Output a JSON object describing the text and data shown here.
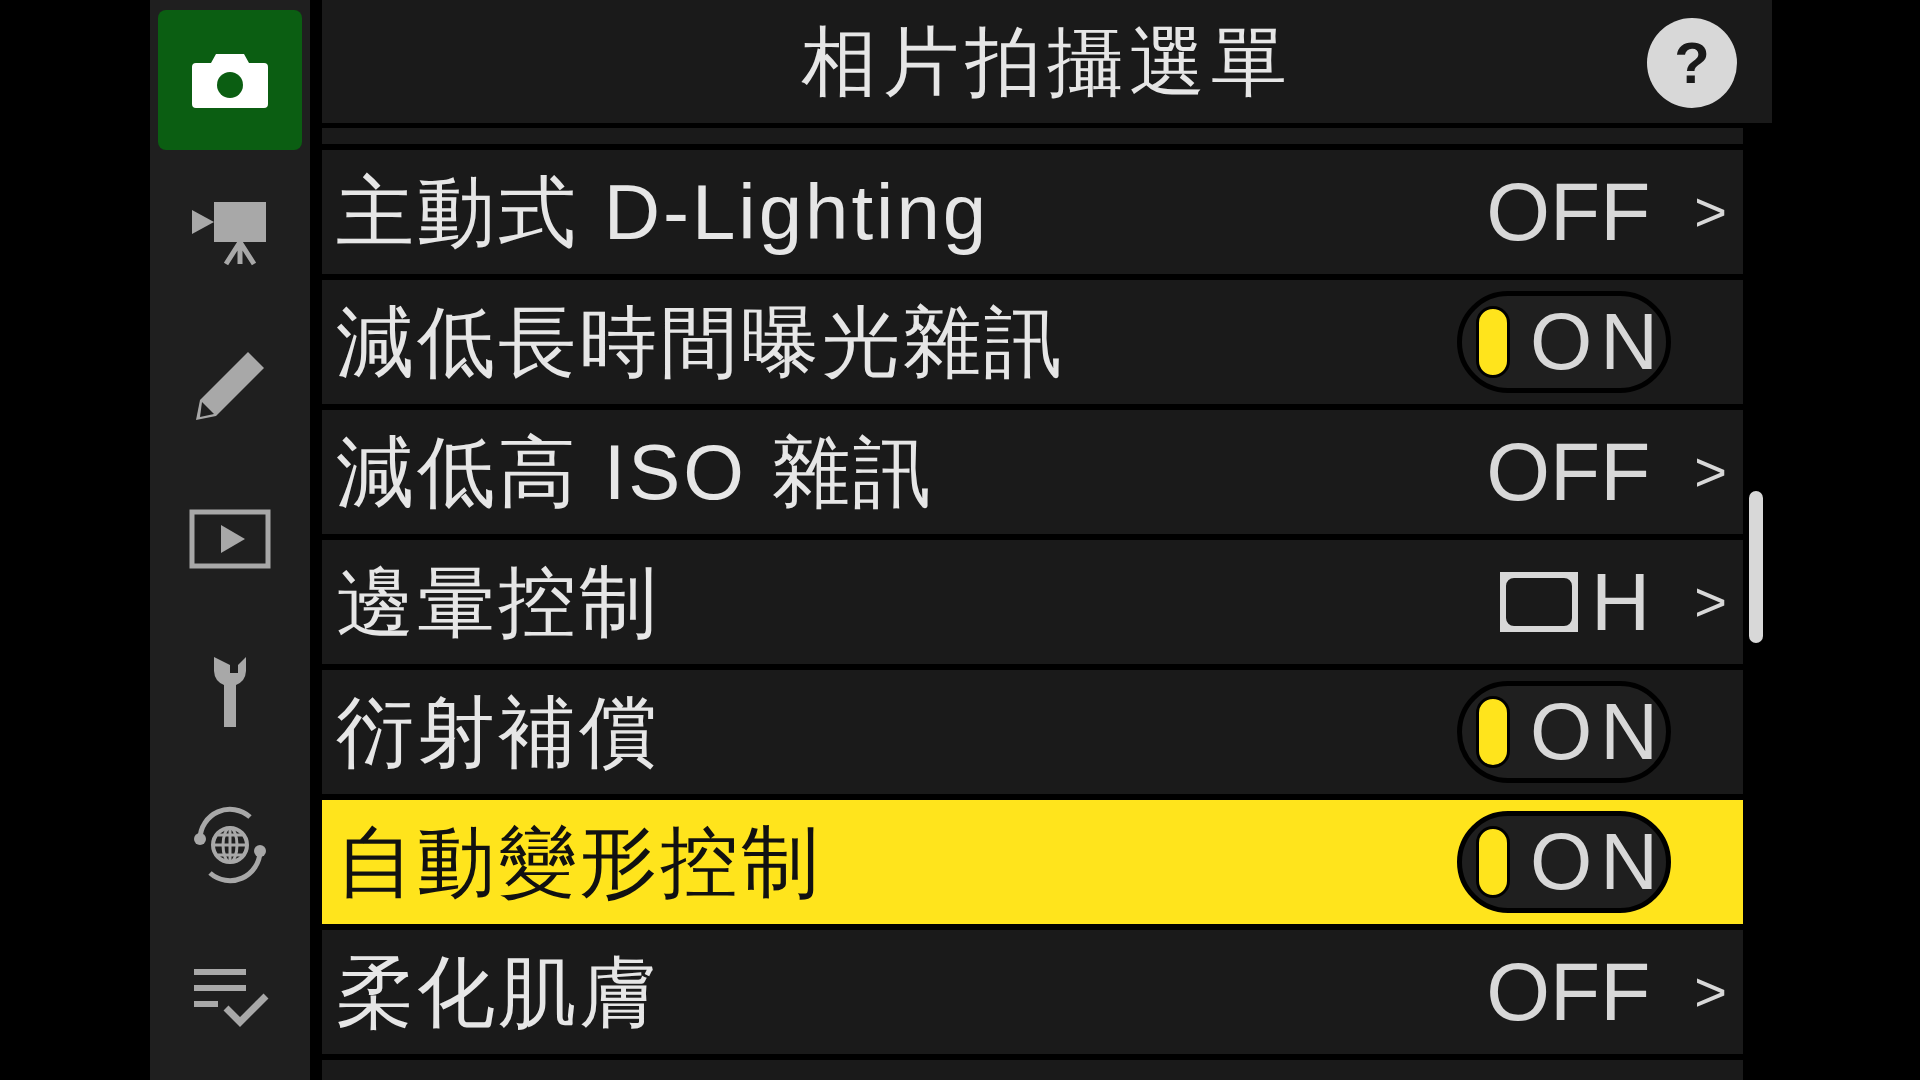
{
  "sidebar": {
    "items": [
      {
        "kind": "photo",
        "selected": true
      },
      {
        "kind": "movie",
        "selected": false
      },
      {
        "kind": "retouch",
        "selected": false
      },
      {
        "kind": "playback",
        "selected": false
      },
      {
        "kind": "setup",
        "selected": false
      },
      {
        "kind": "network",
        "selected": false
      },
      {
        "kind": "mymenu",
        "selected": false
      }
    ]
  },
  "header": {
    "title": "相片拍攝選單",
    "help": "?"
  },
  "menu": {
    "items": [
      {
        "kind": "value",
        "label": "主動式 D-Lighting",
        "value": "OFF",
        "arrow": ">",
        "selected": false
      },
      {
        "kind": "toggle",
        "label": "減低長時間曝光雜訊",
        "value": "ON",
        "on": true,
        "selected": false
      },
      {
        "kind": "value",
        "label": "減低高 ISO 雜訊",
        "value": "OFF",
        "arrow": ">",
        "selected": false
      },
      {
        "kind": "vignette",
        "label": "邊暈控制",
        "value": "H",
        "arrow": ">",
        "selected": false
      },
      {
        "kind": "toggle",
        "label": "衍射補償",
        "value": "ON",
        "on": true,
        "selected": false
      },
      {
        "kind": "toggle",
        "label": "自動變形控制",
        "value": "ON",
        "on": true,
        "selected": true
      },
      {
        "kind": "value",
        "label": "柔化肌膚",
        "value": "OFF",
        "arrow": ">",
        "selected": false
      }
    ]
  }
}
